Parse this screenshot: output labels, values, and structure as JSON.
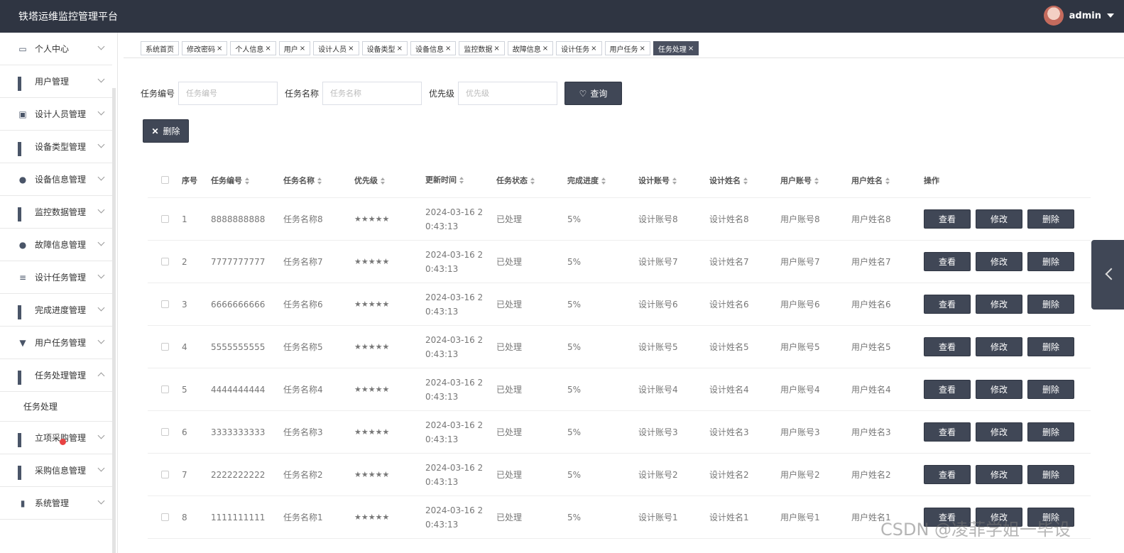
{
  "app": {
    "title": "铁塔运维监控管理平台",
    "user": "admin"
  },
  "sidebar": {
    "items": [
      {
        "label": "个人中心",
        "icon": "profile-card-icon"
      },
      {
        "label": "用户管理",
        "icon": "grid-icon"
      },
      {
        "label": "设计人员管理",
        "icon": "clipboard-icon"
      },
      {
        "label": "设备类型管理",
        "icon": "grid-icon"
      },
      {
        "label": "设备信息管理",
        "icon": "person-icon"
      },
      {
        "label": "监控数据管理",
        "icon": "grid-icon"
      },
      {
        "label": "故障信息管理",
        "icon": "person-icon"
      },
      {
        "label": "设计任务管理",
        "icon": "list-icon"
      },
      {
        "label": "完成进度管理",
        "icon": "grid-icon"
      },
      {
        "label": "用户任务管理",
        "icon": "stamp-icon"
      },
      {
        "label": "任务处理管理",
        "icon": "grid-icon"
      },
      {
        "label": "立项采购管理",
        "icon": "grid-icon"
      },
      {
        "label": "采购信息管理",
        "icon": "grid-icon"
      },
      {
        "label": "系统管理",
        "icon": "chart-icon"
      }
    ],
    "sub_item": "任务处理"
  },
  "tabs": [
    "系统首页",
    "修改密码",
    "个人信息",
    "用户",
    "设计人员",
    "设备类型",
    "设备信息",
    "监控数据",
    "故障信息",
    "设计任务",
    "用户任务",
    "任务处理"
  ],
  "search": {
    "code_label": "任务编号",
    "code_placeholder": "任务编号",
    "name_label": "任务名称",
    "name_placeholder": "任务名称",
    "priority_label": "优先级",
    "priority_placeholder": "优先级",
    "query_button": "查询",
    "delete_button": "删除"
  },
  "table": {
    "headers": [
      "序号",
      "任务编号",
      "任务名称",
      "优先级",
      "更新时间",
      "任务状态",
      "完成进度",
      "设计账号",
      "设计姓名",
      "用户账号",
      "用户姓名",
      "操作"
    ],
    "actions": {
      "view": "查看",
      "edit": "修改",
      "delete": "删除"
    },
    "rows": [
      {
        "idx": "1",
        "code": "8888888888",
        "name": "任务名称8",
        "priority": "★★★★★",
        "time1": "2024-03-16 2",
        "time2": "0:43:13",
        "status": "已处理",
        "progress": "5%",
        "design_acc": "设计账号8",
        "design_name": "设计姓名8",
        "user_acc": "用户账号8",
        "user_name": "用户姓名8"
      },
      {
        "idx": "2",
        "code": "7777777777",
        "name": "任务名称7",
        "priority": "★★★★★",
        "time1": "2024-03-16 2",
        "time2": "0:43:13",
        "status": "已处理",
        "progress": "5%",
        "design_acc": "设计账号7",
        "design_name": "设计姓名7",
        "user_acc": "用户账号7",
        "user_name": "用户姓名7"
      },
      {
        "idx": "3",
        "code": "6666666666",
        "name": "任务名称6",
        "priority": "★★★★★",
        "time1": "2024-03-16 2",
        "time2": "0:43:13",
        "status": "已处理",
        "progress": "5%",
        "design_acc": "设计账号6",
        "design_name": "设计姓名6",
        "user_acc": "用户账号6",
        "user_name": "用户姓名6"
      },
      {
        "idx": "4",
        "code": "5555555555",
        "name": "任务名称5",
        "priority": "★★★★★",
        "time1": "2024-03-16 2",
        "time2": "0:43:13",
        "status": "已处理",
        "progress": "5%",
        "design_acc": "设计账号5",
        "design_name": "设计姓名5",
        "user_acc": "用户账号5",
        "user_name": "用户姓名5"
      },
      {
        "idx": "5",
        "code": "4444444444",
        "name": "任务名称4",
        "priority": "★★★★★",
        "time1": "2024-03-16 2",
        "time2": "0:43:13",
        "status": "已处理",
        "progress": "5%",
        "design_acc": "设计账号4",
        "design_name": "设计姓名4",
        "user_acc": "用户账号4",
        "user_name": "用户姓名4"
      },
      {
        "idx": "6",
        "code": "3333333333",
        "name": "任务名称3",
        "priority": "★★★★★",
        "time1": "2024-03-16 2",
        "time2": "0:43:13",
        "status": "已处理",
        "progress": "5%",
        "design_acc": "设计账号3",
        "design_name": "设计姓名3",
        "user_acc": "用户账号3",
        "user_name": "用户姓名3"
      },
      {
        "idx": "7",
        "code": "2222222222",
        "name": "任务名称2",
        "priority": "★★★★★",
        "time1": "2024-03-16 2",
        "time2": "0:43:13",
        "status": "已处理",
        "progress": "5%",
        "design_acc": "设计账号2",
        "design_name": "设计姓名2",
        "user_acc": "用户账号2",
        "user_name": "用户姓名2"
      },
      {
        "idx": "8",
        "code": "1111111111",
        "name": "任务名称1",
        "priority": "★★★★★",
        "time1": "2024-03-16 2",
        "time2": "0:43:13",
        "status": "已处理",
        "progress": "5%",
        "design_acc": "设计账号1",
        "design_name": "设计姓名1",
        "user_acc": "用户账号1",
        "user_name": "用户姓名1"
      }
    ]
  },
  "watermark": "CSDN @凌菲学姐一毕设"
}
